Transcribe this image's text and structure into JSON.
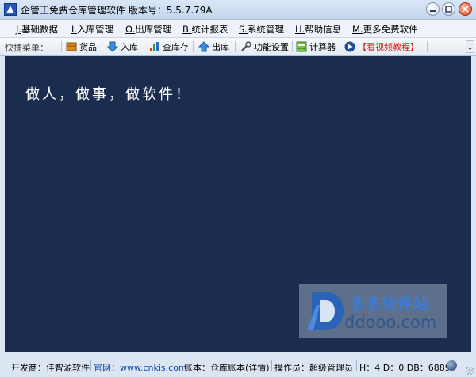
{
  "window": {
    "title": "企管王免费仓库管理软件 版本号：5.5.7.79A"
  },
  "menu": [
    {
      "key": "J.",
      "label": "基础数据"
    },
    {
      "key": "I.",
      "label": "入库管理"
    },
    {
      "key": "O.",
      "label": "出库管理"
    },
    {
      "key": "B.",
      "label": "统计报表"
    },
    {
      "key": "S.",
      "label": "系统管理"
    },
    {
      "key": "H.",
      "label": "帮助信息"
    },
    {
      "key": "M.",
      "label": "更多免费软件"
    }
  ],
  "toolbar": {
    "label": "快捷菜单：",
    "items": [
      {
        "label": "货品",
        "icon": "goods-icon"
      },
      {
        "label": "入库",
        "icon": "arrow-down-icon"
      },
      {
        "label": "查库存",
        "icon": "bar-chart-icon"
      },
      {
        "label": "出库",
        "icon": "arrow-up-icon"
      },
      {
        "label": "功能设置",
        "icon": "tools-icon"
      },
      {
        "label": "计算器",
        "icon": "calculator-icon"
      },
      {
        "label": "【看视频教程】",
        "icon": "play-icon",
        "color": "#e0201a"
      }
    ]
  },
  "main": {
    "slogan": "做人，做事，做软件！",
    "background": "#1a2d4f"
  },
  "watermark": {
    "cn": "多多软件站",
    "en": "ddooo.com"
  },
  "status": {
    "developer": "开发商：佳智源软件",
    "website_label": "官网：www.cnkis.com",
    "account": "账本：仓库账本(详情)",
    "operator": "操作员：超级管理员",
    "db_info": "H：4 D：0 DB：6889"
  }
}
